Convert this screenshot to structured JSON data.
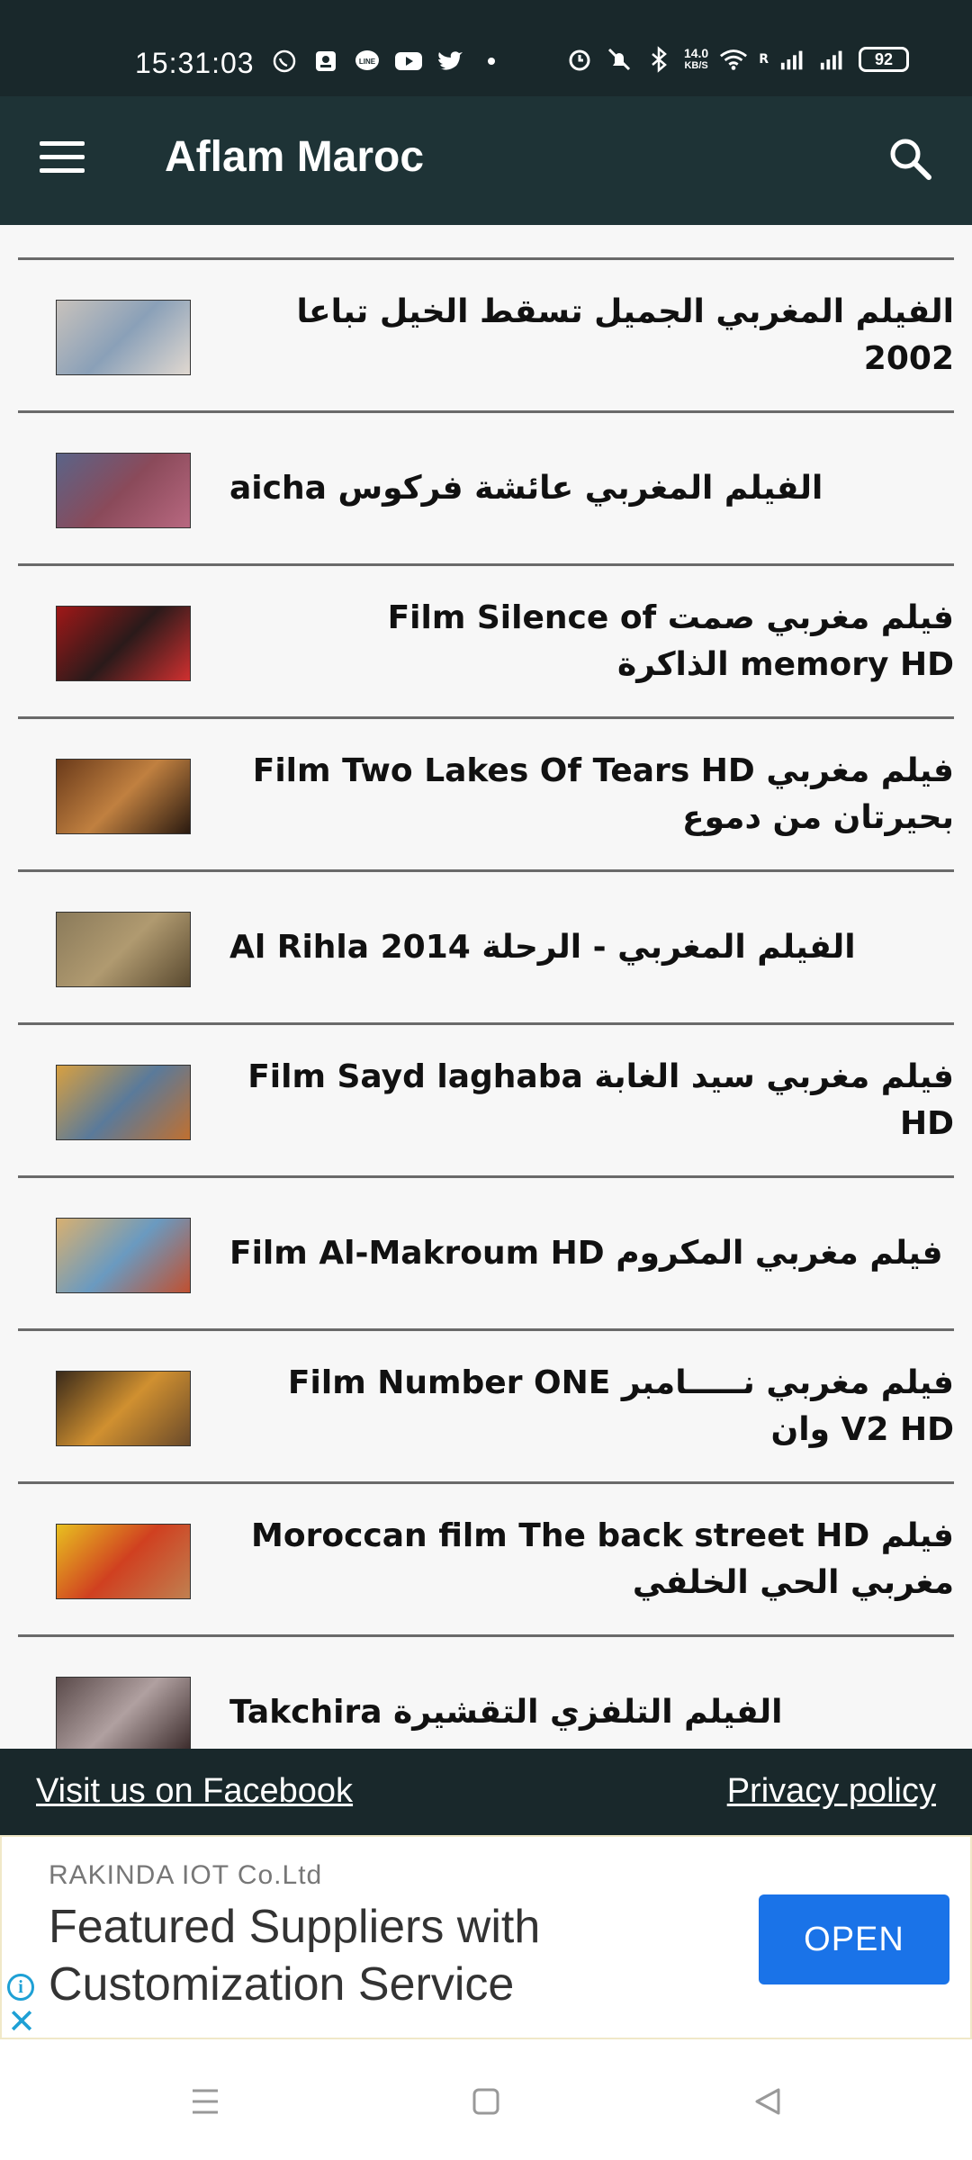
{
  "status_bar": {
    "time": "15:31:03",
    "net_speed_value": "14.0",
    "net_speed_unit": "KB/S",
    "roaming": "R",
    "battery": "92"
  },
  "app_bar": {
    "title": "Aflam Maroc",
    "menu_icon": "hamburger-icon",
    "search_icon": "search-icon"
  },
  "movies": [
    {
      "title": "الفيلم المغربي الجميل تسقط الخيل تباعا 2002",
      "thumb_colors": [
        "#c8c2bc",
        "#8aa0b8",
        "#e0d8d0"
      ]
    },
    {
      "title": "الفيلم المغربي   عائشة   فركوس  aicha",
      "thumb_colors": [
        "#5a6488",
        "#8a4a5a",
        "#b86880"
      ]
    },
    {
      "title": "فيلم مغربي صمت  Film Silence of memory  HD الذاكرة",
      "thumb_colors": [
        "#a01818",
        "#2a1a1a",
        "#d03030"
      ]
    },
    {
      "title": "فيلم مغربي  Film Two Lakes Of Tears HD بحيرتان من دموع",
      "thumb_colors": [
        "#6a3a1a",
        "#c08040",
        "#2a1a10"
      ]
    },
    {
      "title": "الفيلم المغربي - الرحلة  Al Rihla 2014",
      "thumb_colors": [
        "#8a7a5a",
        "#b09a70",
        "#5a4a30"
      ]
    },
    {
      "title": "فيلم مغربي سيد الغابة  Film Sayd laghaba HD",
      "thumb_colors": [
        "#d8a040",
        "#5a7a9a",
        "#c07030"
      ]
    },
    {
      "title": "فيلم مغربي المكروم  Film Al-Makroum HD",
      "thumb_colors": [
        "#d8b070",
        "#6a9ac0",
        "#c05030"
      ]
    },
    {
      "title": "فيلم مغربي نـــــامبر  Film Number ONE V2 HD وان",
      "thumb_colors": [
        "#3a2a1a",
        "#d09030",
        "#6a4a2a"
      ]
    },
    {
      "title": "فيلم  Moroccan film The back street HD مغربي الحي الخلفي",
      "thumb_colors": [
        "#e8c020",
        "#d04020",
        "#c08050"
      ]
    },
    {
      "title": "الفيلم التلفزي التقشيرة  Takchira",
      "thumb_colors": [
        "#5a4a4a",
        "#b0a0a0",
        "#3a2a2a"
      ]
    }
  ],
  "footer": {
    "facebook_link": "Visit us on Facebook",
    "privacy_link": "Privacy policy"
  },
  "ad": {
    "advertiser": "RAKINDA IOT Co.Ltd",
    "headline": "Featured Suppliers with Customization Service",
    "cta": "OPEN",
    "info_icon": "info-icon",
    "close_icon": "close-icon"
  },
  "nav_bar": {
    "buttons": [
      "recents-icon",
      "home-icon",
      "back-icon"
    ]
  },
  "colors": {
    "status_bar": "#19282b",
    "app_bar": "#1e3336",
    "list_bg": "#f7f7f7",
    "ad_button": "#1a73e8"
  }
}
